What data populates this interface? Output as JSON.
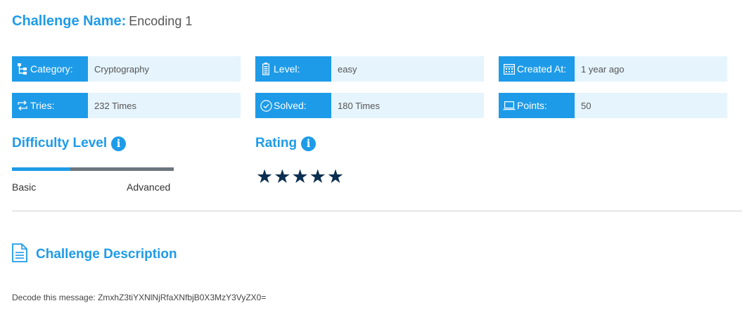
{
  "challenge": {
    "name_label": "Challenge Name:",
    "name_value": "Encoding 1"
  },
  "info": {
    "category": {
      "label": "Category:",
      "value": "Cryptography",
      "icon": "sitemap-icon"
    },
    "level": {
      "label": "Level:",
      "value": "easy",
      "icon": "battery-icon"
    },
    "created_at": {
      "label": "Created At:",
      "value": "1 year ago",
      "icon": "calendar-icon"
    },
    "tries": {
      "label": "Tries:",
      "value": "232 Times",
      "icon": "retweet-icon"
    },
    "solved": {
      "label": "Solved:",
      "value": "180 Times",
      "icon": "check-circle-icon"
    },
    "points": {
      "label": "Points:",
      "value": "50",
      "icon": "laptop-icon"
    }
  },
  "difficulty": {
    "title": "Difficulty Level",
    "level_fraction": 0.36,
    "min_label": "Basic",
    "max_label": "Advanced"
  },
  "rating": {
    "title": "Rating",
    "stars": 5,
    "max_stars": 5
  },
  "description": {
    "title": "Challenge Description",
    "text": "Decode this message: ZmxhZ3tiYXNlNjRfaXNfbjB0X3MzY3VyZX0="
  },
  "colors": {
    "accent": "#1e9be8",
    "info_bg": "#e6f4fd",
    "bar_track": "#6c757d",
    "star": "#0b2f50"
  }
}
